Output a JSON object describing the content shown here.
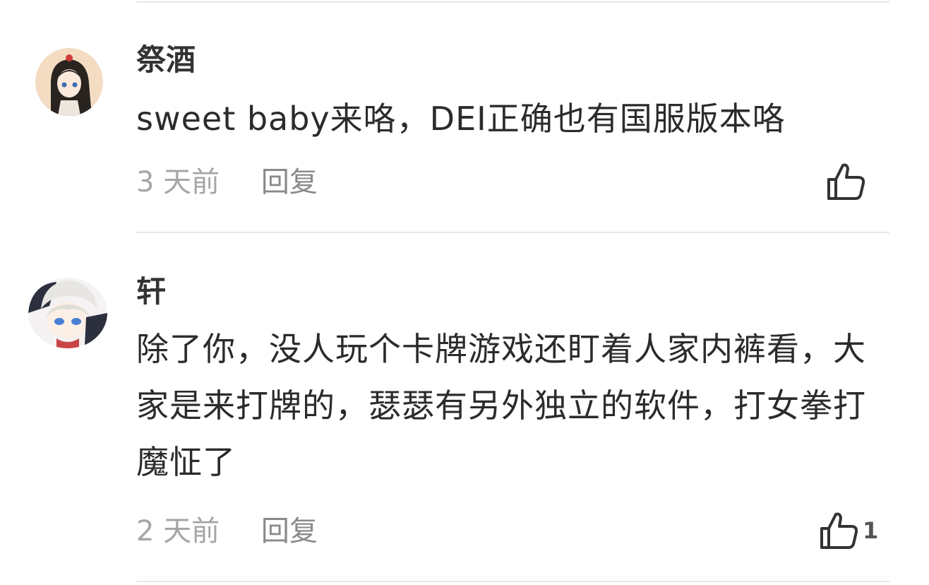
{
  "comments": [
    {
      "username": "祭酒",
      "content": "sweet baby来咯，DEI正确也有国服版本咯",
      "time": "3 天前",
      "reply_label": "回复",
      "like_count": ""
    },
    {
      "username": "轩",
      "content": "除了你，没人玩个卡牌游戏还盯着人家内裤看，大家是来打牌的，瑟瑟有另外独立的软件，打女拳打魔怔了",
      "time": "2 天前",
      "reply_label": "回复",
      "like_count": "1"
    }
  ],
  "icons": {
    "like": "thumbs-up-icon"
  }
}
